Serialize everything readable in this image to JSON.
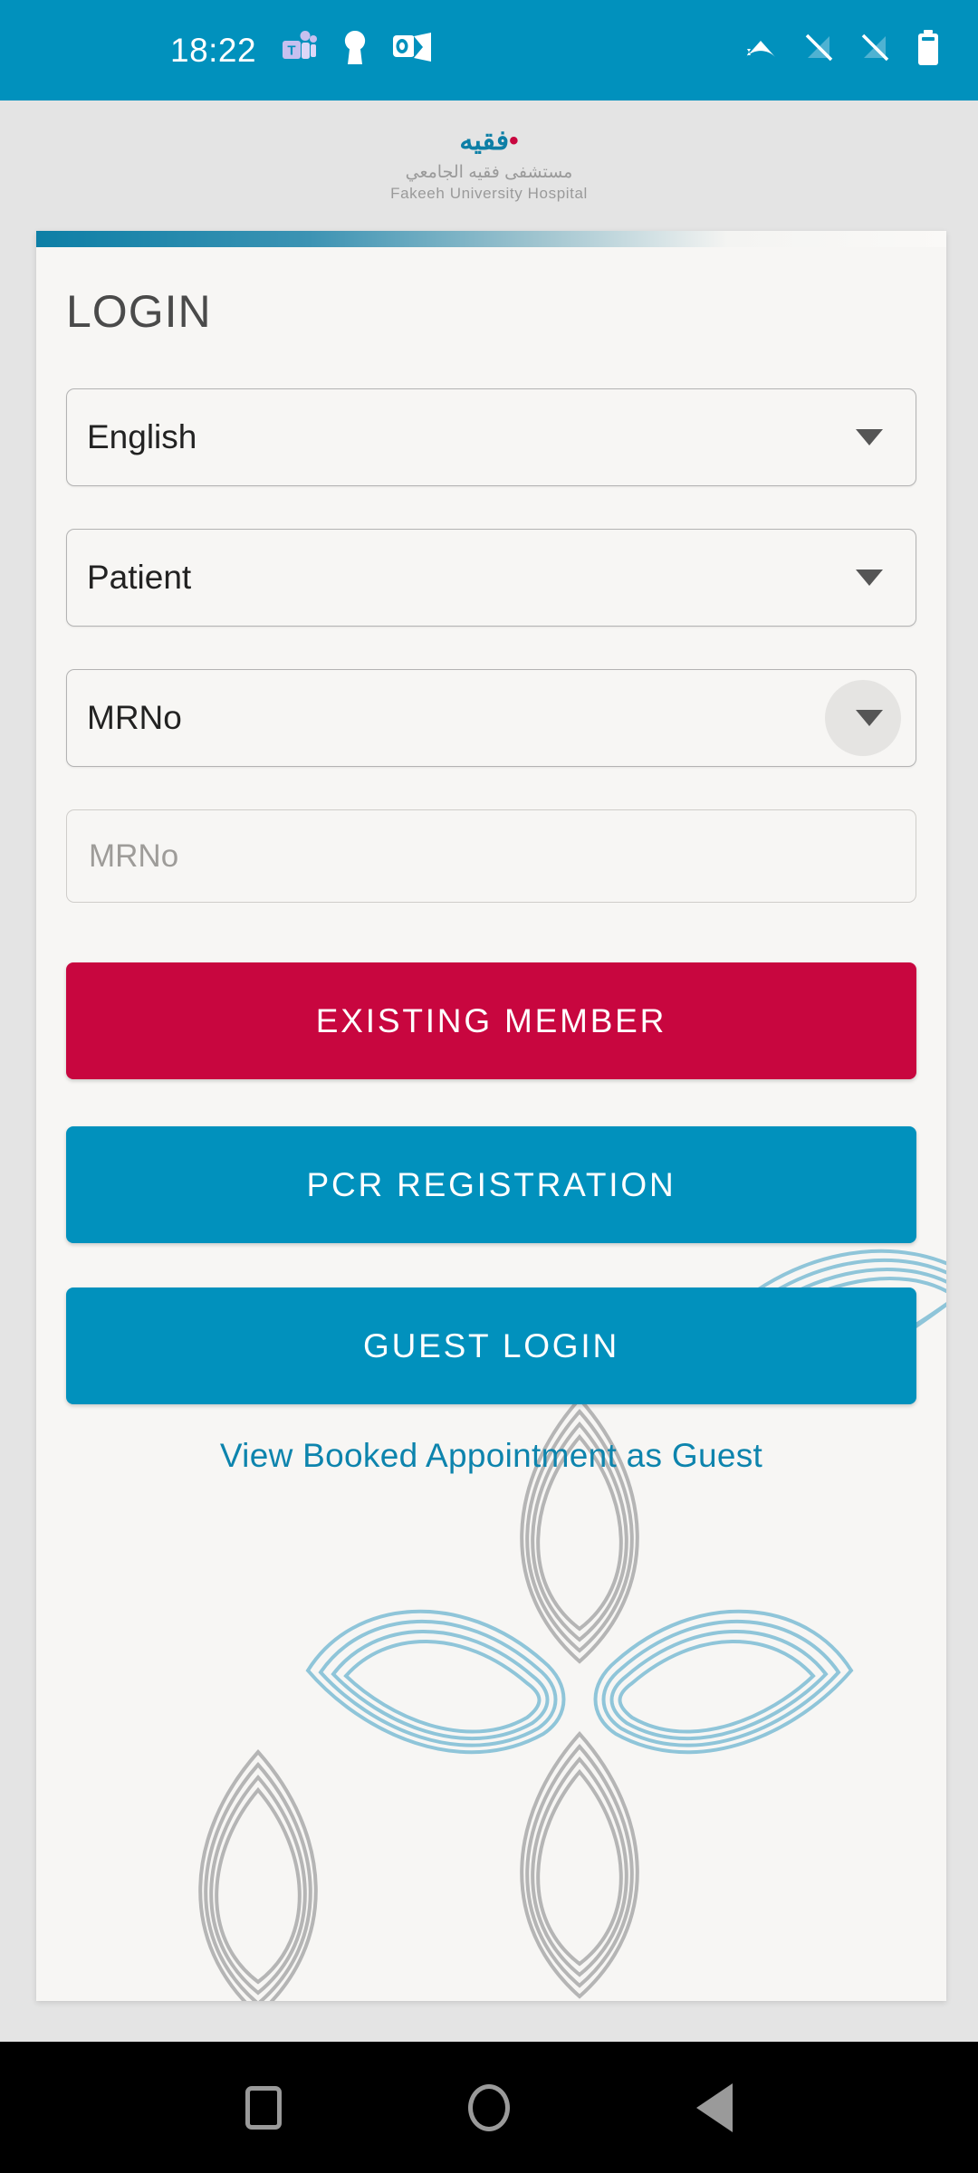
{
  "statusbar": {
    "time": "18:22",
    "left_icons": [
      "teams-icon",
      "vpn-key-icon",
      "outlook-icon"
    ],
    "right_icons": [
      "wifi-icon",
      "signal-off-icon",
      "signal-off-icon-2",
      "battery-icon"
    ],
    "background_color": "#0191bd"
  },
  "header": {
    "logo_arabic": "فقيه",
    "logo_dot": "•",
    "logo_subtitle_ar": "مستشفى فقيه الجامعي",
    "logo_subtitle_en": "Fakeeh University Hospital",
    "logo_color": "#0d7fa6",
    "logo_dot_color": "#c8063f"
  },
  "card": {
    "title": "LOGIN",
    "accent_gradient_from": "#0d7fa6",
    "accent_gradient_to": "#faf9f7"
  },
  "form": {
    "language_select": {
      "value": "English",
      "icon": "chevron-down-icon"
    },
    "user_type_select": {
      "value": "Patient",
      "icon": "chevron-down-icon"
    },
    "id_type_select": {
      "value": "MRNo",
      "icon": "chevron-down-icon",
      "state": "pressed"
    },
    "id_input": {
      "value": "",
      "placeholder": "MRNo"
    }
  },
  "actions": {
    "existing_member": {
      "label": "EXISTING MEMBER",
      "color": "#c8063f"
    },
    "pcr_registration": {
      "label": "PCR REGISTRATION",
      "color": "#0191bd"
    },
    "guest_login": {
      "label": "GUEST LOGIN",
      "color": "#0191bd"
    },
    "guest_appointment_link": {
      "label": "View Booked Appointment as Guest",
      "color": "#0d84ad"
    }
  },
  "decoration": {
    "name": "fakeeh-floral-motif",
    "petal_blue": "#8fc5d9",
    "petal_grey": "#b5b5b5"
  },
  "navbar": {
    "recents_label": "recents",
    "home_label": "home",
    "back_label": "back"
  }
}
